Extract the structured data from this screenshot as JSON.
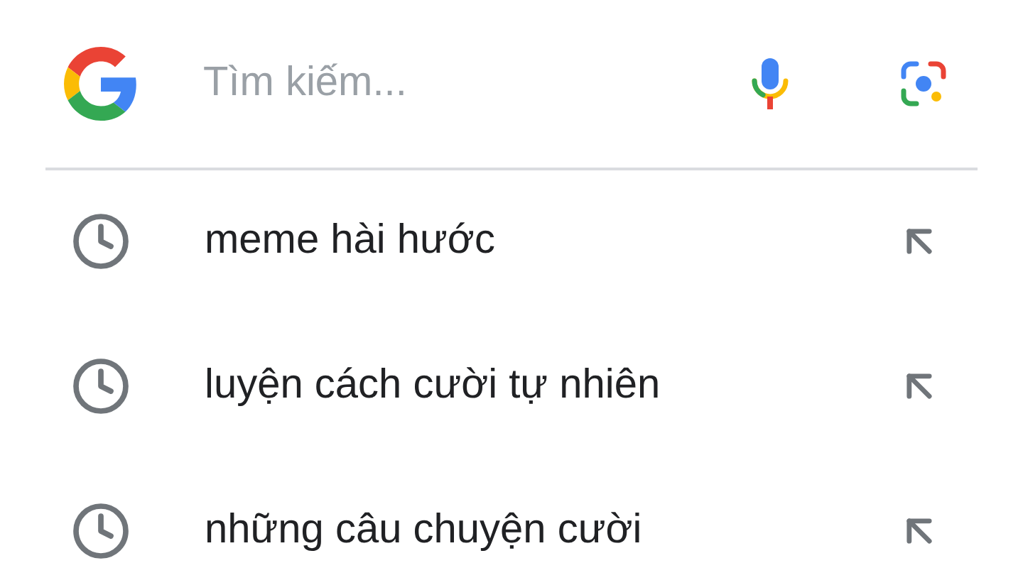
{
  "search": {
    "placeholder": "Tìm kiếm..."
  },
  "suggestions": [
    {
      "text": "meme hài hước"
    },
    {
      "text": "luyện cách cười tự nhiên"
    },
    {
      "text": "những câu chuyện cười"
    }
  ]
}
